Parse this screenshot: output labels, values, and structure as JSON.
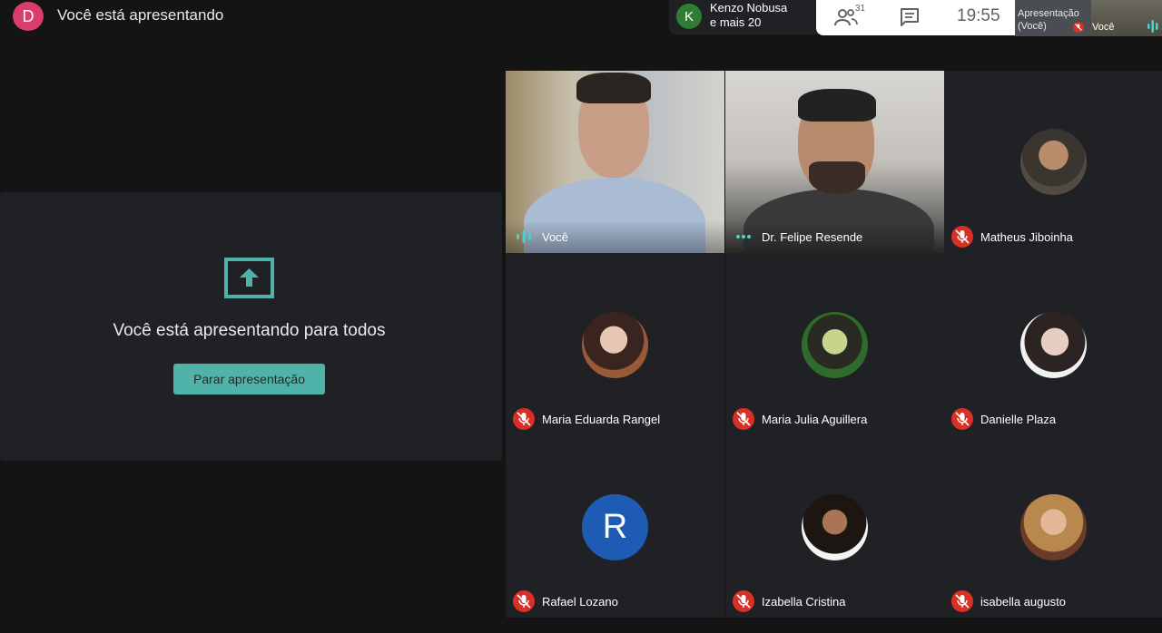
{
  "topbar": {
    "avatar_letter": "D",
    "title": "Você está apresentando"
  },
  "pinned": {
    "avatar_letter": "K",
    "name": "Kenzo Nobusa",
    "more": "e mais 20"
  },
  "controls": {
    "participants_count": "31",
    "time": "19:55"
  },
  "self_view": {
    "presentation_label_1": "Apresentação",
    "presentation_label_2": "(Você)",
    "you_label": "Você"
  },
  "presentation_panel": {
    "message": "Você está apresentando para todos",
    "stop_button": "Parar apresentação"
  },
  "participants": [
    {
      "name": "Você",
      "kind": "video",
      "mic": "speaking"
    },
    {
      "name": "Dr. Felipe Resende",
      "kind": "video",
      "mic": "active"
    },
    {
      "name": "Matheus Jiboinha",
      "kind": "photo",
      "mic": "muted"
    },
    {
      "name": "Maria Eduarda Rangel",
      "kind": "photo",
      "mic": "muted"
    },
    {
      "name": "Maria Julia Aguillera",
      "kind": "photo",
      "mic": "muted"
    },
    {
      "name": "Danielle Plaza",
      "kind": "photo",
      "mic": "muted"
    },
    {
      "name": "Rafael Lozano",
      "kind": "letter",
      "letter": "R",
      "mic": "muted"
    },
    {
      "name": "Izabella Cristina",
      "kind": "photo",
      "mic": "muted"
    },
    {
      "name": "isabella augusto",
      "kind": "photo",
      "mic": "muted"
    }
  ],
  "colors": {
    "accent": "#4fb3aa",
    "muted_red": "#d93025",
    "tile_bg": "#202124",
    "rafael_avatar": "#1e5bb5"
  }
}
